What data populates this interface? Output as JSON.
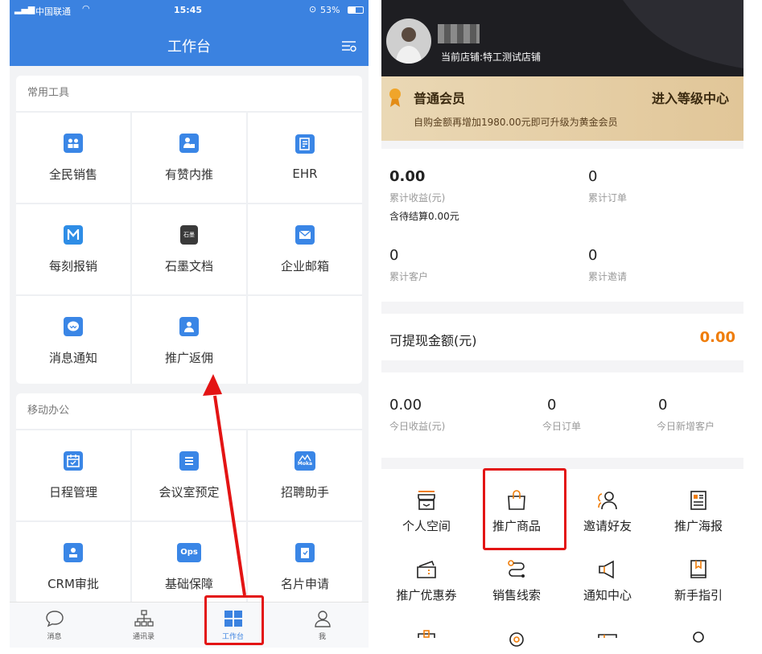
{
  "left": {
    "status": {
      "carrier": "中国联通",
      "time": "15:45",
      "battery": "53%"
    },
    "header": {
      "title": "工作台"
    },
    "common_tools": {
      "title": "常用工具",
      "items": [
        {
          "label": "全民销售",
          "icon": "people-icon"
        },
        {
          "label": "有赞内推",
          "icon": "person-card-icon"
        },
        {
          "label": "EHR",
          "icon": "document-icon"
        },
        {
          "label": "每刻报销",
          "icon": "m-logo-icon"
        },
        {
          "label": "石墨文档",
          "icon": "shimo-logo-icon",
          "text": "石墨"
        },
        {
          "label": "企业邮箱",
          "icon": "mail-icon"
        },
        {
          "label": "消息通知",
          "icon": "chat-bubble-icon"
        },
        {
          "label": "推广返佣",
          "icon": "person-badge-icon"
        }
      ]
    },
    "mobile_office": {
      "title": "移动办公",
      "items": [
        {
          "label": "日程管理",
          "icon": "calendar-icon"
        },
        {
          "label": "会议室预定",
          "icon": "list-icon"
        },
        {
          "label": "招聘助手",
          "icon": "moka-logo-icon",
          "text": "Moka"
        },
        {
          "label": "CRM审批",
          "icon": "person-stamp-icon"
        },
        {
          "label": "基础保障",
          "icon": "ops-logo-icon",
          "text": "Ops"
        },
        {
          "label": "名片申请",
          "icon": "clipboard-icon"
        }
      ]
    },
    "tabbar": [
      {
        "label": "消息",
        "icon": "chat-icon"
      },
      {
        "label": "通讯录",
        "icon": "org-chart-icon"
      },
      {
        "label": "工作台",
        "icon": "grid-icon",
        "active": true
      },
      {
        "label": "我",
        "icon": "user-icon"
      }
    ],
    "colors": {
      "brand": "#3b82e0",
      "accent": "#e31414"
    }
  },
  "right": {
    "profile": {
      "store": "当前店铺:特工测试店铺"
    },
    "member": {
      "level": "普通会员",
      "link": "进入等级中心",
      "hint": "自购金额再增加1980.00元即可升级为黄金会员"
    },
    "stats": [
      {
        "value": "0.00",
        "caption": "累计收益(元)",
        "bold": true
      },
      {
        "value": "0",
        "caption": "累计订单"
      },
      {
        "value": "0",
        "caption": "累计客户"
      },
      {
        "value": "0",
        "caption": "累计邀请"
      }
    ],
    "pending": "含待结算0.00元",
    "withdraw": {
      "label": "可提现金额(元)",
      "value": "0.00"
    },
    "today": [
      {
        "value": "0.00",
        "caption": "今日收益(元)"
      },
      {
        "value": "0",
        "caption": "今日订单"
      },
      {
        "value": "0",
        "caption": "今日新增客户"
      }
    ],
    "services": [
      {
        "label": "个人空间",
        "icon": "shop-icon"
      },
      {
        "label": "推广商品",
        "icon": "bag-icon"
      },
      {
        "label": "邀请好友",
        "icon": "users-icon"
      },
      {
        "label": "推广海报",
        "icon": "poster-icon"
      },
      {
        "label": "推广优惠券",
        "icon": "coupon-icon"
      },
      {
        "label": "销售线索",
        "icon": "route-icon"
      },
      {
        "label": "通知中心",
        "icon": "megaphone-icon"
      },
      {
        "label": "新手指引",
        "icon": "book-icon"
      }
    ],
    "colors": {
      "orange": "#ef7d0a",
      "gold_band": "#e9d3aa"
    }
  }
}
